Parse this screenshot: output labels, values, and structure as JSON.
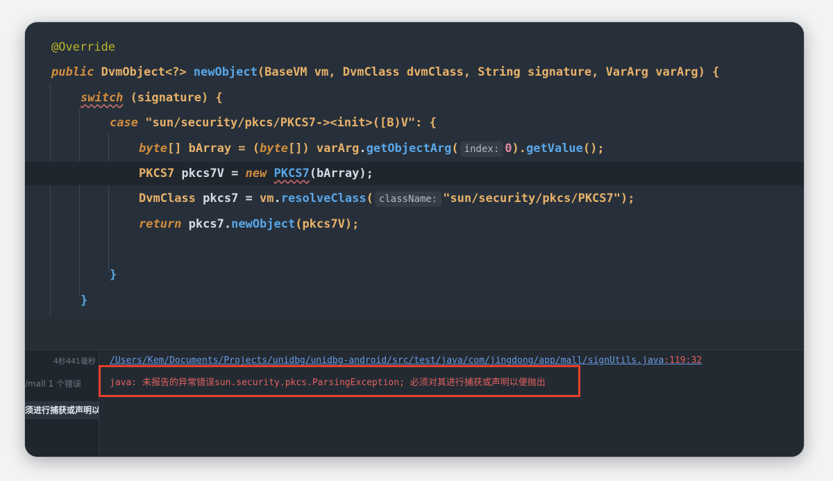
{
  "code": {
    "annotation": "@Override",
    "sig": {
      "public": "public",
      "ret": "DvmObject<?>",
      "name": "newObject",
      "lp": "(",
      "t1": "BaseVM",
      "p1": "vm",
      "c1": ", ",
      "t2": "DvmClass",
      "p2": "dvmClass",
      "c2": ", ",
      "t3": "String",
      "p3": "signature",
      "c3": ", ",
      "t4": "VarArg",
      "p4": "varArg",
      "rp": ") {"
    },
    "sw": {
      "kw": "switch",
      "rest": " (signature) {"
    },
    "cs": {
      "kw": "case",
      "str": "\"sun/security/pkcs/PKCS7-><init>([B)V\"",
      "rest": ": {"
    },
    "l1": {
      "t": "byte",
      "a": "[] bArray = (",
      "t2": "byte",
      "b": "[]) ",
      "v": "varArg",
      "d": ".",
      "m": "getObjectArg",
      "lp": "(",
      "hint": "index:",
      "num": "0",
      "rp": ").",
      "m2": "getValue",
      "e": "();"
    },
    "l2": {
      "t": "PKCS7",
      "a": " pkcs7V = ",
      "kw": "new",
      "sp": " ",
      "cls": "PKCS7",
      "e": "(bArray);"
    },
    "l3": {
      "t": "DvmClass",
      "a": " pkcs7 = ",
      "v": "vm",
      "d": ".",
      "m": "resolveClass",
      "lp": "(",
      "hint": "className:",
      "str": "\"sun/security/pkcs/PKCS7\"",
      "e": ");"
    },
    "l4": {
      "kw": "return",
      "a": " pkcs7.",
      "m": "newObject",
      "e": "(pkcs7V);"
    },
    "close_case": "}",
    "close_switch": "}"
  },
  "problems": {
    "time": "4秒441毫秒",
    "module": "/mall 1 个错误",
    "selected": "须进行捕获或声明以",
    "path": "/Users/Kem/Documents/Projects/unidbg/unidbg-android/src/test/java/com/jingdong/app/mall/signUtils.java",
    "pos": ":119:32",
    "message": "java: 未报告的异常错误sun.security.pkcs.ParsingException; 必须对其进行捕获或声明以便抛出"
  },
  "colors": {
    "error_box": "#e8402d",
    "error_text": "#e36262",
    "link": "#6a9be6"
  }
}
